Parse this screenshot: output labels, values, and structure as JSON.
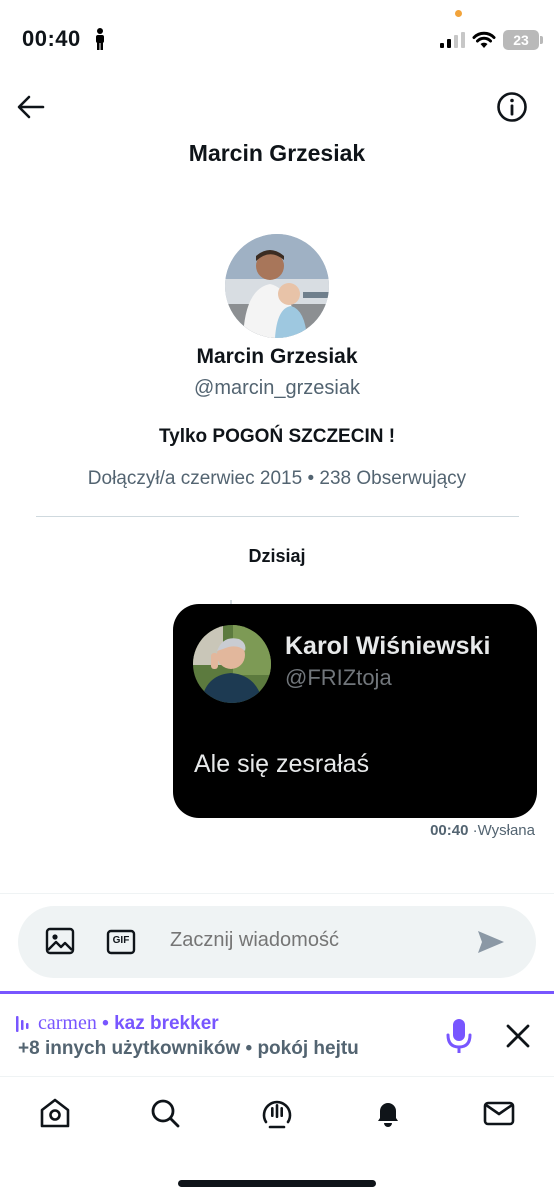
{
  "status_bar": {
    "time": "00:40",
    "battery": "23"
  },
  "header": {
    "title": "Marcin Grzesiak"
  },
  "profile": {
    "name": "Marcin Grzesiak",
    "handle": "@marcin_grzesiak",
    "bio": "Tylko POGOŃ SZCZECIN !",
    "meta": "Dołączył/a czerwiec 2015 • 238 Obserwujący"
  },
  "conversation": {
    "date_separator": "Dzisiaj",
    "message": {
      "quoted_tweet": {
        "author_name": "Karol Wiśniewski",
        "author_handle": "@FRIZtoja",
        "text": "Ale się zesrałaś"
      },
      "time": "00:40",
      "status": "·Wysłana"
    }
  },
  "composer": {
    "placeholder": "Zacznij wiadomość",
    "gif_label": "GIF"
  },
  "space_banner": {
    "host_1": "carmen",
    "separator": " • ",
    "host_2": "kaz brekker",
    "subtitle": "+8 innych użytkowników • pokój hejtu"
  },
  "nav": {
    "items": [
      "home-icon",
      "search-icon",
      "spaces-icon",
      "notifications-icon",
      "messages-icon"
    ]
  },
  "colors": {
    "accent": "#7856ff",
    "text_primary": "#0f1419",
    "text_secondary": "#536471",
    "card_bg": "#000000"
  }
}
